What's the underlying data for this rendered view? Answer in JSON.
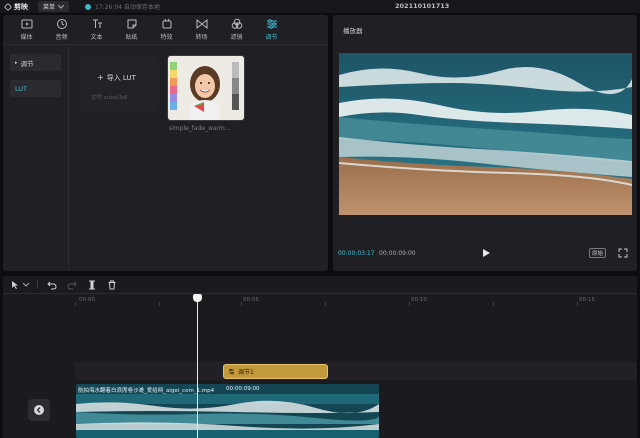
{
  "app": {
    "name": "剪映",
    "menu_label": "菜单",
    "autosave_text": "17:26:04 自动保存本地",
    "project_title": "202110101713"
  },
  "tabs": [
    {
      "label": "媒体",
      "icon": "media-icon"
    },
    {
      "label": "音频",
      "icon": "audio-icon"
    },
    {
      "label": "文本",
      "icon": "text-icon"
    },
    {
      "label": "贴纸",
      "icon": "sticker-icon"
    },
    {
      "label": "特效",
      "icon": "effects-icon"
    },
    {
      "label": "转场",
      "icon": "transition-icon"
    },
    {
      "label": "滤镜",
      "icon": "filter-icon"
    },
    {
      "label": "调节",
      "icon": "adjust-icon",
      "active": true
    }
  ],
  "sidebar": {
    "section_label": "调节",
    "items": [
      {
        "label": "LUT",
        "active": true
      }
    ]
  },
  "lut_panel": {
    "import_label": "导入 LUT",
    "import_hint": "文件 cube/3dl",
    "lut_items": [
      {
        "caption": "simple_fade_warm..."
      }
    ]
  },
  "player": {
    "title": "播放器",
    "time_current": "00:00:03:17",
    "time_total": "00:00:09:00",
    "ratio_label": "原始"
  },
  "timeline": {
    "ruler_labels": [
      "00:00",
      "00:05",
      "00:10",
      "00:15"
    ],
    "adjust_clip_label": "调节1",
    "video_clip_label": "航拍海水翻着白浪席卷沙滩_爱给网_aigei_com_1.mp4",
    "video_clip_duration": "00:00:09:00"
  },
  "colors": {
    "accent": "#3fbfd4",
    "adjust_clip": "#c29a3a",
    "panel": "#1f1f24"
  }
}
